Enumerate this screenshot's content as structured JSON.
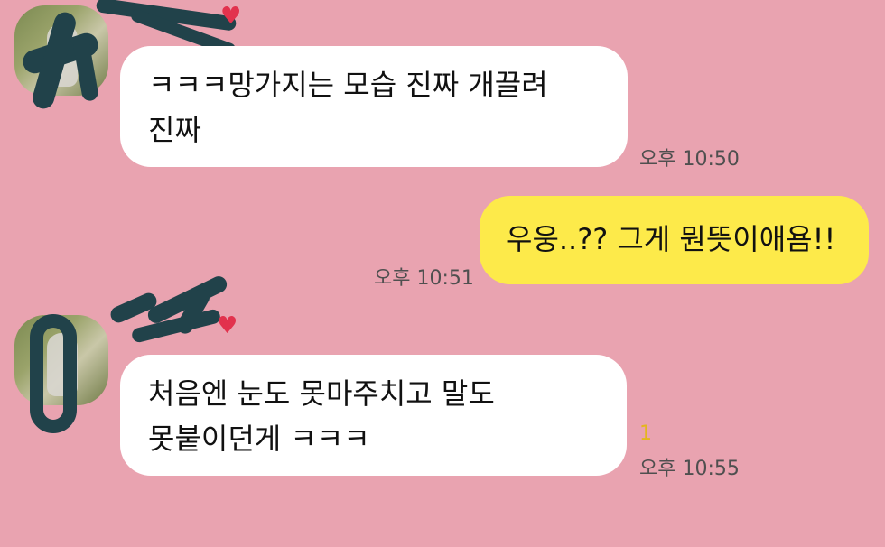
{
  "chat": {
    "messages": [
      {
        "sender": "friend",
        "lines": [
          "ㅋㅋㅋ망가지는 모습 진짜 개끌려",
          "진짜"
        ],
        "time": "오후 10:50"
      },
      {
        "sender": "me",
        "lines": [
          "우웅..?? 그게 뭔뜻이애욤!!"
        ],
        "time": "오후 10:51"
      },
      {
        "sender": "friend",
        "lines": [
          "처음엔 눈도 못마주치고 말도",
          "못붙이던게 ㅋㅋㅋ"
        ],
        "time": "오후 10:55",
        "unread_count": "1"
      }
    ],
    "icons": {
      "heart": "♥",
      "avatar": "profile-photo",
      "redaction": "scribble"
    },
    "colors": {
      "background": "#e9a3b0",
      "friend_bubble": "#ffffff",
      "my_bubble": "#fdea4a",
      "unread": "#e4b61e",
      "heart": "#e2324d"
    }
  }
}
